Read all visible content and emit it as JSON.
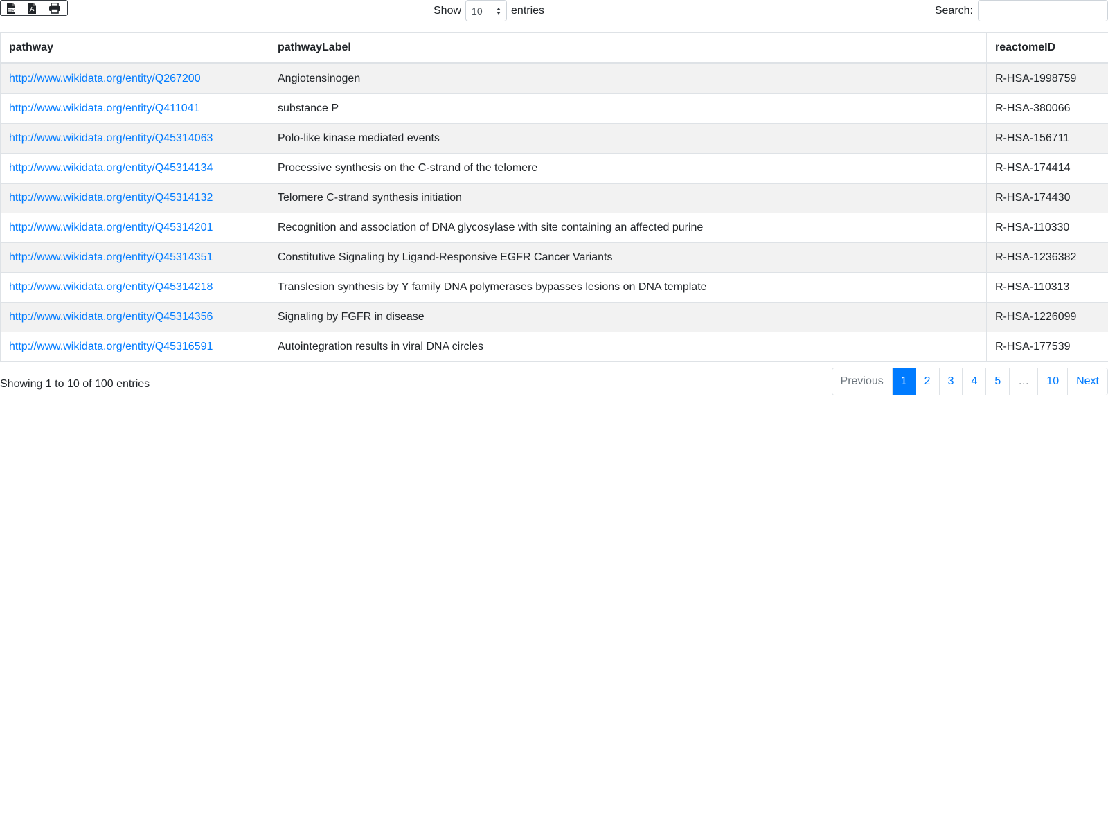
{
  "export_buttons": [
    {
      "name": "csv-file-icon"
    },
    {
      "name": "pdf-file-icon"
    },
    {
      "name": "print-icon"
    }
  ],
  "length": {
    "prefix": "Show",
    "value": "10",
    "suffix": "entries"
  },
  "search": {
    "label": "Search:",
    "value": ""
  },
  "table": {
    "columns": [
      "pathway",
      "pathwayLabel",
      "reactomeID"
    ],
    "rows": [
      {
        "pathway": "http://www.wikidata.org/entity/Q267200",
        "label": "Angiotensinogen",
        "reactome": "R-HSA-1998759"
      },
      {
        "pathway": "http://www.wikidata.org/entity/Q411041",
        "label": "substance P",
        "reactome": "R-HSA-380066"
      },
      {
        "pathway": "http://www.wikidata.org/entity/Q45314063",
        "label": "Polo-like kinase mediated events",
        "reactome": "R-HSA-156711"
      },
      {
        "pathway": "http://www.wikidata.org/entity/Q45314134",
        "label": "Processive synthesis on the C-strand of the telomere",
        "reactome": "R-HSA-174414"
      },
      {
        "pathway": "http://www.wikidata.org/entity/Q45314132",
        "label": "Telomere C-strand synthesis initiation",
        "reactome": "R-HSA-174430"
      },
      {
        "pathway": "http://www.wikidata.org/entity/Q45314201",
        "label": "Recognition and association of DNA glycosylase with site containing an affected purine",
        "reactome": "R-HSA-110330"
      },
      {
        "pathway": "http://www.wikidata.org/entity/Q45314351",
        "label": "Constitutive Signaling by Ligand-Responsive EGFR Cancer Variants",
        "reactome": "R-HSA-1236382"
      },
      {
        "pathway": "http://www.wikidata.org/entity/Q45314218",
        "label": "Translesion synthesis by Y family DNA polymerases bypasses lesions on DNA template",
        "reactome": "R-HSA-110313"
      },
      {
        "pathway": "http://www.wikidata.org/entity/Q45314356",
        "label": "Signaling by FGFR in disease",
        "reactome": "R-HSA-1226099"
      },
      {
        "pathway": "http://www.wikidata.org/entity/Q45316591",
        "label": "Autointegration results in viral DNA circles",
        "reactome": "R-HSA-177539"
      }
    ]
  },
  "info": "Showing 1 to 10 of 100 entries",
  "pagination": {
    "previous": "Previous",
    "pages": [
      "1",
      "2",
      "3",
      "4",
      "5",
      "…",
      "10"
    ],
    "current": "1",
    "next": "Next"
  },
  "colors": {
    "link": "#007bff",
    "active_page": "#007bff",
    "stripe": "#f2f2f2"
  }
}
